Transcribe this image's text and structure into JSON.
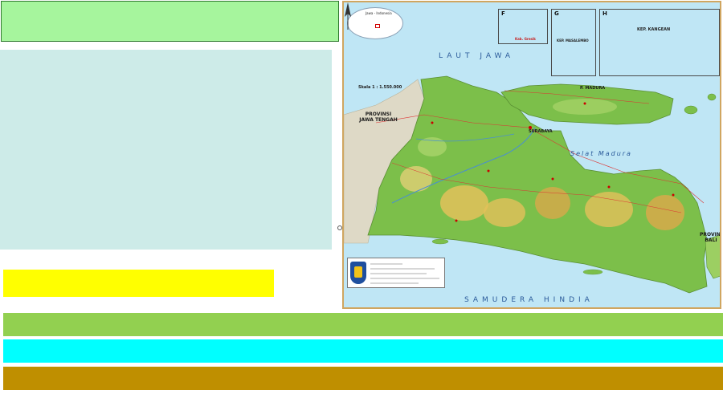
{
  "map": {
    "seas": {
      "java_sea": "LAUT JAWA",
      "madura_strait": "Selat Madura",
      "indian_ocean": "SAMUDERA HINDIA"
    },
    "provinces": {
      "central_java": "PROVINSI JAWA TENGAH",
      "bali": "PROVINSI BALI"
    },
    "cities": {
      "surabaya": "SURABAYA",
      "madura": "P. MADURA"
    },
    "scale": "Skala 1 : 1.550.000",
    "locator_title": "Jawa - Indonesia",
    "insets": [
      {
        "letter": "F",
        "caption": "Kab. Gresik"
      },
      {
        "letter": "G",
        "caption": "KEP. MASALEMBO"
      },
      {
        "letter": "H",
        "caption": "KEP. KANGEAN"
      }
    ],
    "colors": {
      "sea": "#bfe6f5",
      "lowland": "#7cbf4a",
      "upland": "#e3c15a",
      "frame": "#d0a660"
    }
  }
}
